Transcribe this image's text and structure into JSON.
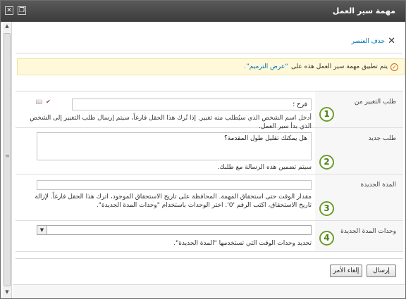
{
  "window": {
    "title": "مهمة سير العمل",
    "close_glyph": "✕",
    "maximize_glyph": "❐"
  },
  "toolbar": {
    "delete_label": "حذف العنصر",
    "delete_icon": "close-x-icon"
  },
  "status": {
    "prefix": "يتم تطبيق مهمة سير العمل هذه على",
    "link": "“عرض الترميم”."
  },
  "fields": [
    {
      "number": "1",
      "label": "طلب التغيير من",
      "value": "فرح ؛",
      "description": "أدخل اسم الشخص الذي سيُطلب منه تغيير. إذا تُرك هذا الحقل فارغاً، سيتم إرسال طلب التغيير إلى الشخص الذي بدأ سير العمل."
    },
    {
      "number": "2",
      "label": "طلب جديد",
      "value": "هل يمكنك تقليل طول المقدمة؟",
      "description": "سيتم تضمين هذه الرسالة مع طلبك."
    },
    {
      "number": "3",
      "label": "المدة الجديدة",
      "value": "",
      "description": "مقدار الوقت حتى استحقاق المهمة. المحافظة على تاريخ الاستحقاق الموجود، اترك هذا الحقل فارغاً. لإزالة تاريخ الاستحقاق، اكتب الرقم '0'. اختر الوحدات باستخدام \"وحدات المدة الجديدة\"."
    },
    {
      "number": "4",
      "label": "وحدات المدة الجديدة",
      "value": "",
      "description": "تحديد وحدات الوقت التي تستخدمها \"المدة الجديدة\"."
    }
  ],
  "buttons": {
    "send": "إرسال",
    "cancel": "إلغاء الأمر"
  },
  "colors": {
    "title_bar": "#4a4a4a",
    "link": "#0072bc",
    "status_bg": "#fff9d9",
    "number_badge": "#6b9e29"
  }
}
